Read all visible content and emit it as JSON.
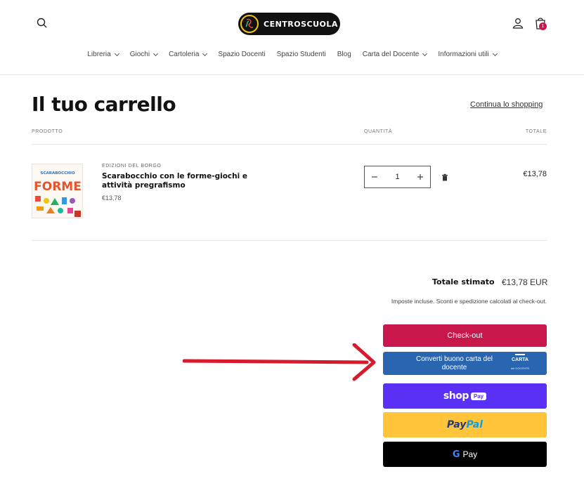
{
  "header": {
    "logo_text": "CENTROSCUOLA",
    "cart_count": "1",
    "icons": {
      "search": "search-icon",
      "account": "user-icon",
      "cart": "bag-icon"
    }
  },
  "nav": [
    {
      "label": "Libreria",
      "dropdown": true
    },
    {
      "label": "Giochi",
      "dropdown": true
    },
    {
      "label": "Cartoleria",
      "dropdown": true
    },
    {
      "label": "Spazio Docenti",
      "dropdown": false
    },
    {
      "label": "Spazio Studenti",
      "dropdown": false
    },
    {
      "label": "Blog",
      "dropdown": false
    },
    {
      "label": "Carta del Docente",
      "dropdown": true
    },
    {
      "label": "Informazioni utili",
      "dropdown": true
    }
  ],
  "cart": {
    "title": "Il tuo carrello",
    "continue_link": "Continua lo shopping",
    "columns": {
      "product": "PRODOTTO",
      "quantity": "QUANTITÀ",
      "total": "TOTALE"
    },
    "items": [
      {
        "vendor": "EDIZIONI DEL BORGO",
        "title": "Scarabocchio con le forme-giochi e attività pregrafismo",
        "price": "€13,78",
        "quantity": "1",
        "line_total": "€13,78",
        "thumb_text_top": "SCARABOCCHIO",
        "thumb_text_main": "FORME"
      }
    ],
    "subtotal_label": "Totale stimato",
    "subtotal_value": "€13,78 EUR",
    "tax_note": "Imposte incluse. Sconti e spedizione calcolati al check-out."
  },
  "buttons": {
    "checkout": "Check-out",
    "carta_docente": "Converti buono carta del docente",
    "carta_logo": "CARTA",
    "carta_logo_sub": "del DOCENTE",
    "shop_pay_word": "shop",
    "shop_pay_badge": "Pay",
    "paypal_a": "Pay",
    "paypal_b": "Pal",
    "gpay_g": "G",
    "gpay_word": "Pay"
  },
  "colors": {
    "checkout": "#c8174b",
    "carta": "#2a66b0",
    "shop_pay": "#5a31f4",
    "paypal": "#ffc439",
    "gpay": "#000000",
    "arrow": "#d81b2c"
  }
}
